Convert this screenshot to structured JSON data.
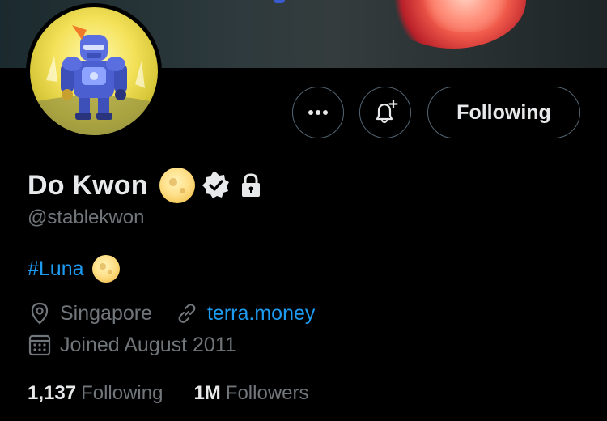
{
  "profile": {
    "name": "Do Kwon",
    "handle": "@stablekwon",
    "bio_hashtag": "#Luna",
    "location": "Singapore",
    "website": "terra.money",
    "joined": "Joined August 2011",
    "verified": true,
    "protected": true
  },
  "actions": {
    "more_icon": "more-horizontal-icon",
    "bell_icon": "bell-plus-icon",
    "following_label": "Following"
  },
  "stats": {
    "following_count": "1,137",
    "following_label": "Following",
    "followers_count": "1M",
    "followers_label": "Followers"
  },
  "colors": {
    "background": "#000000",
    "text_primary": "#e7e9ea",
    "text_secondary": "#71767b",
    "link": "#1d9bf0",
    "border": "#536471"
  }
}
